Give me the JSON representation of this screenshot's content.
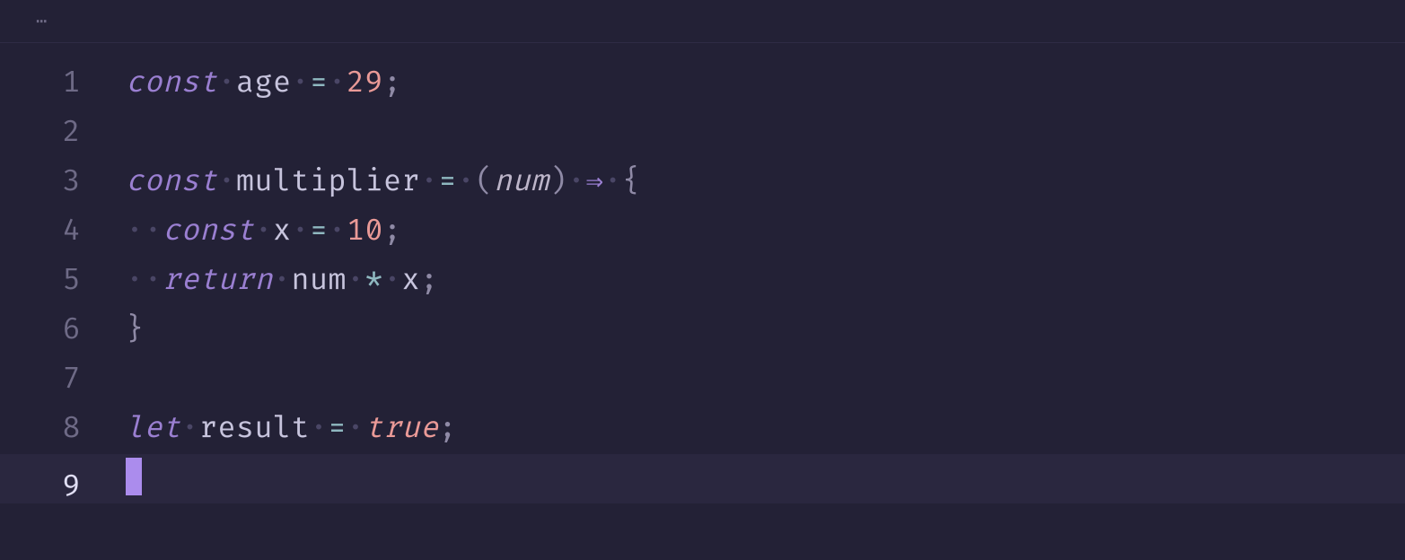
{
  "tab": {
    "ellipsis": "⋯"
  },
  "colors": {
    "background": "#232136",
    "current_line": "#2a273f",
    "keyword": "#9a7fd1",
    "identifier": "#c7c4dd",
    "number": "#ea9a97",
    "operator": "#8fb8c0",
    "punctuation": "#8f8aa6",
    "whitespace": "#4a4666",
    "cursor": "#ab8ced",
    "gutter": "#6e6a86",
    "gutter_active": "#e0def4"
  },
  "cursor_line": 9,
  "lines": [
    {
      "n": "1",
      "tokens": [
        {
          "t": "const",
          "c": "keyword"
        },
        {
          "t": "·",
          "c": "ws"
        },
        {
          "t": "age",
          "c": "ident"
        },
        {
          "t": "·",
          "c": "ws"
        },
        {
          "t": "=",
          "c": "op"
        },
        {
          "t": "·",
          "c": "ws"
        },
        {
          "t": "29",
          "c": "number"
        },
        {
          "t": ";",
          "c": "punc"
        }
      ]
    },
    {
      "n": "2",
      "tokens": []
    },
    {
      "n": "3",
      "tokens": [
        {
          "t": "const",
          "c": "keyword"
        },
        {
          "t": "·",
          "c": "ws"
        },
        {
          "t": "multiplier",
          "c": "fnname"
        },
        {
          "t": "·",
          "c": "ws"
        },
        {
          "t": "=",
          "c": "op"
        },
        {
          "t": "·",
          "c": "ws"
        },
        {
          "t": "(",
          "c": "paren"
        },
        {
          "t": "num",
          "c": "param"
        },
        {
          "t": ")",
          "c": "paren"
        },
        {
          "t": "·",
          "c": "ws"
        },
        {
          "t": "⇒",
          "c": "arrow"
        },
        {
          "t": "·",
          "c": "ws"
        },
        {
          "t": "{",
          "c": "brace"
        }
      ]
    },
    {
      "n": "4",
      "tokens": [
        {
          "t": "··",
          "c": "ws"
        },
        {
          "t": "const",
          "c": "keyword"
        },
        {
          "t": "·",
          "c": "ws"
        },
        {
          "t": "x",
          "c": "ident"
        },
        {
          "t": "·",
          "c": "ws"
        },
        {
          "t": "=",
          "c": "op"
        },
        {
          "t": "·",
          "c": "ws"
        },
        {
          "t": "10",
          "c": "number"
        },
        {
          "t": ";",
          "c": "punc"
        }
      ]
    },
    {
      "n": "5",
      "tokens": [
        {
          "t": "··",
          "c": "ws"
        },
        {
          "t": "return",
          "c": "keyword"
        },
        {
          "t": "·",
          "c": "ws"
        },
        {
          "t": "num",
          "c": "ident"
        },
        {
          "t": "·",
          "c": "ws"
        },
        {
          "t": "*",
          "c": "star"
        },
        {
          "t": "·",
          "c": "ws"
        },
        {
          "t": "x",
          "c": "ident"
        },
        {
          "t": ";",
          "c": "punc"
        }
      ]
    },
    {
      "n": "6",
      "tokens": [
        {
          "t": "}",
          "c": "brace"
        }
      ]
    },
    {
      "n": "7",
      "tokens": []
    },
    {
      "n": "8",
      "tokens": [
        {
          "t": "let",
          "c": "keyword"
        },
        {
          "t": "·",
          "c": "ws"
        },
        {
          "t": "result",
          "c": "ident"
        },
        {
          "t": "·",
          "c": "ws"
        },
        {
          "t": "=",
          "c": "op"
        },
        {
          "t": "·",
          "c": "ws"
        },
        {
          "t": "true",
          "c": "bool"
        },
        {
          "t": ";",
          "c": "punc"
        }
      ]
    },
    {
      "n": "9",
      "tokens": [],
      "current": true
    }
  ]
}
